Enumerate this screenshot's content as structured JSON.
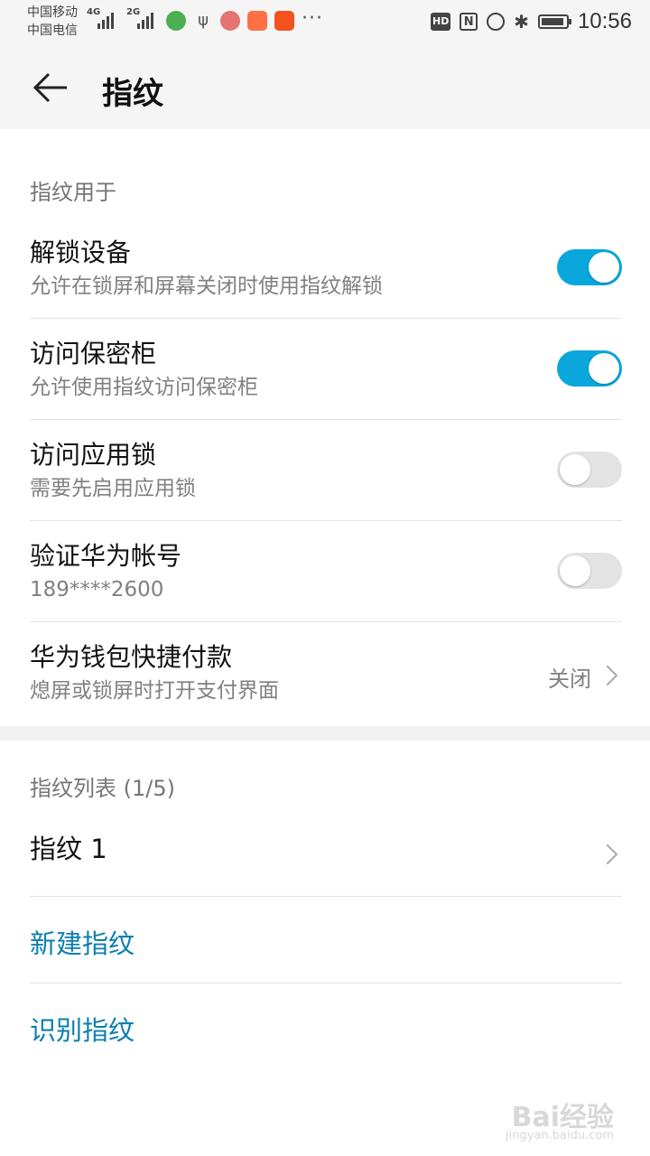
{
  "status": {
    "carrier1": "中国移动",
    "carrier2": "中国电信",
    "sim1_type": "4G",
    "sim2_type": "2G",
    "overflow": "···",
    "hd": "HD",
    "nfc": "N",
    "time": "10:56"
  },
  "appbar": {
    "title": "指纹"
  },
  "usage": {
    "header": "指纹用于",
    "items": [
      {
        "label": "解锁设备",
        "desc": "允许在锁屏和屏幕关闭时使用指纹解锁",
        "enabled": true
      },
      {
        "label": "访问保密柜",
        "desc": "允许使用指纹访问保密柜",
        "enabled": true
      },
      {
        "label": "访问应用锁",
        "desc": "需要先启用应用锁",
        "enabled": false
      },
      {
        "label": "验证华为帐号",
        "desc": "189****2600",
        "enabled": false
      }
    ],
    "wallet": {
      "label": "华为钱包快捷付款",
      "desc": "熄屏或锁屏时打开支付界面",
      "value": "关闭"
    }
  },
  "fingerprints": {
    "header": "指纹列表 (1/5)",
    "items": [
      {
        "label": "指纹 1"
      }
    ],
    "new_label": "新建指纹",
    "identify_label": "识别指纹"
  },
  "colors": {
    "accent": "#09a7dc",
    "link": "#0b7fae"
  },
  "watermark": {
    "line1": "Bai经验",
    "line2": "jingyan.baidu.com"
  }
}
